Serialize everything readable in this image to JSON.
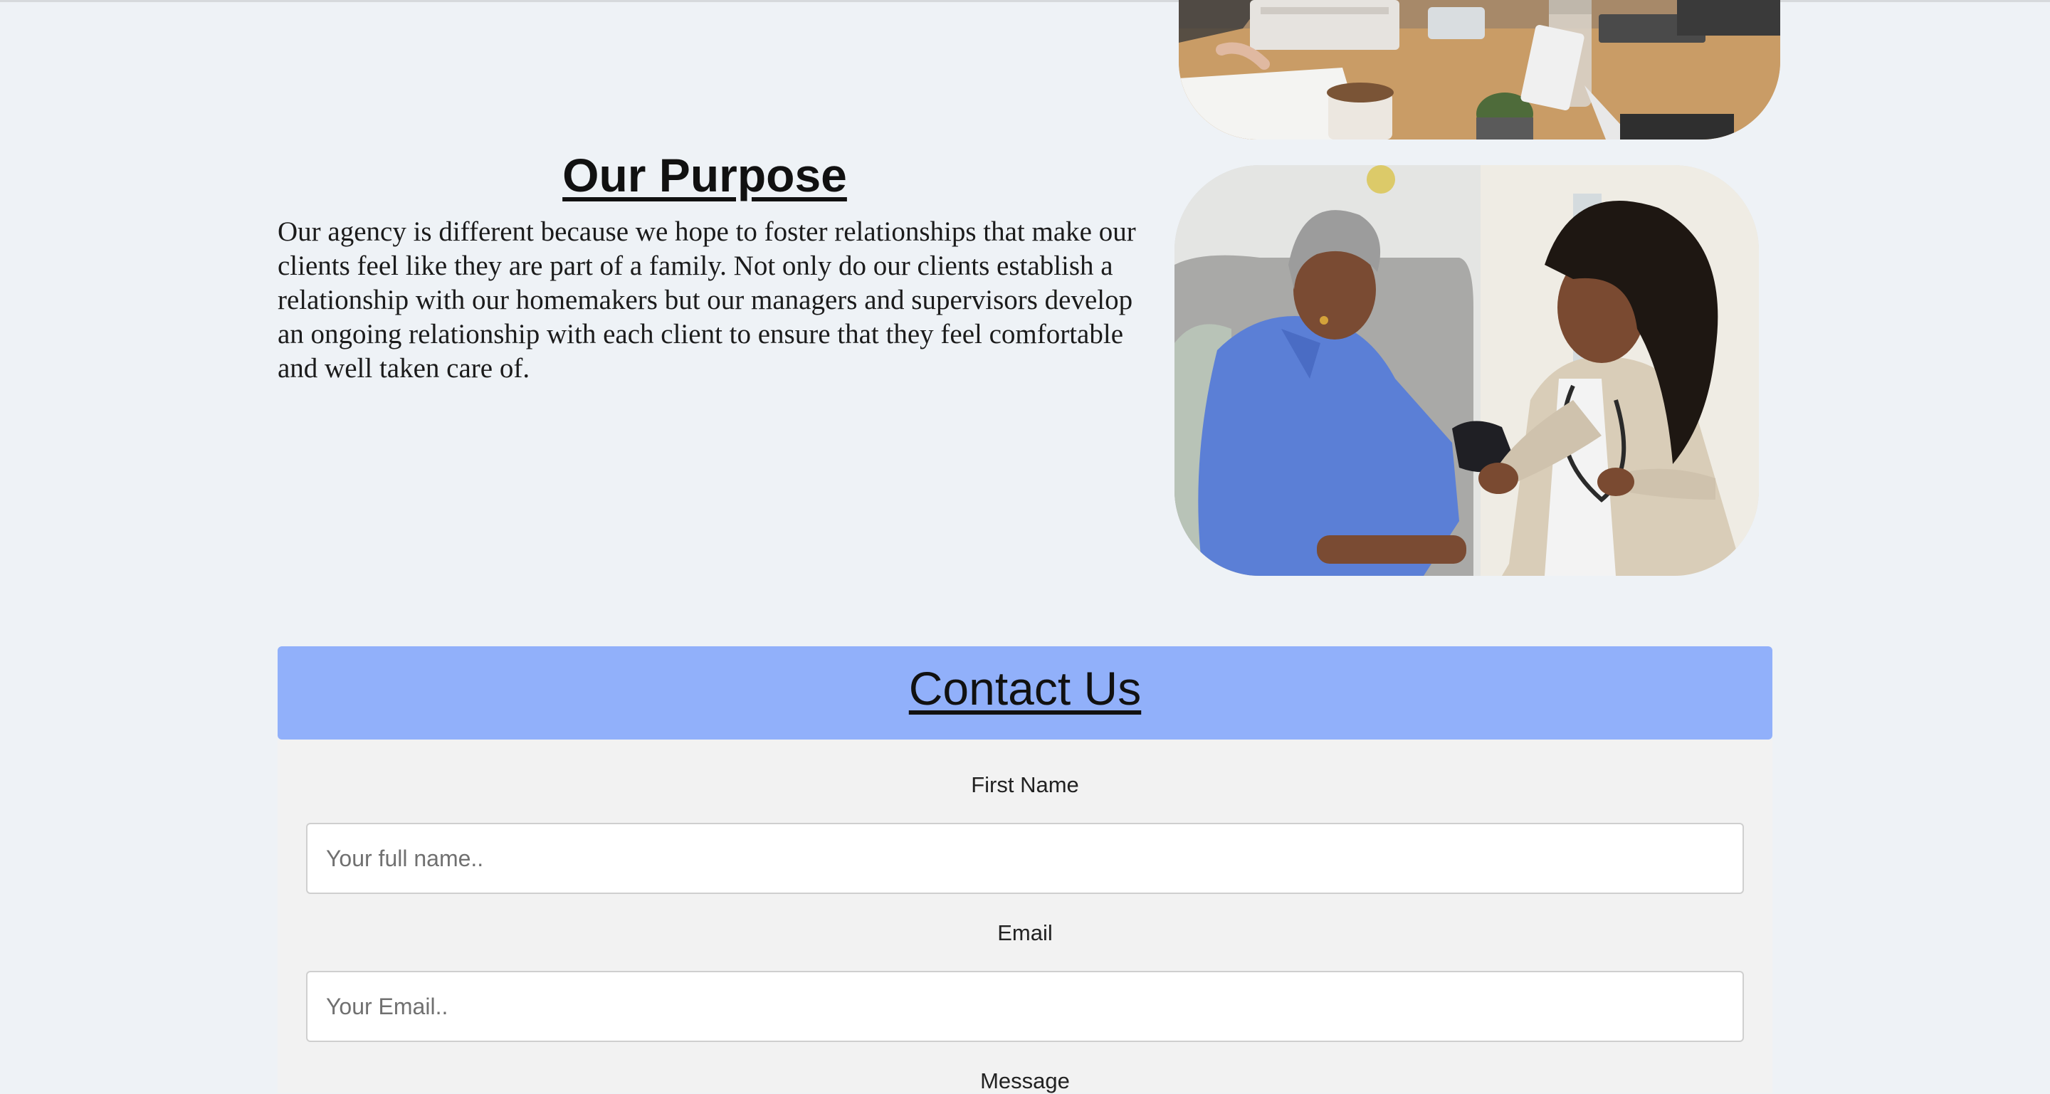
{
  "purpose": {
    "title": "Our Purpose",
    "body": "Our agency is different because we hope to foster relationships that make our clients feel like they are part of a family. Not only do our clients establish a relationship with our homemakers but our managers and supervisors develop an ongoing relationship with each client to ensure that they feel comfortable and well taken care of."
  },
  "contact": {
    "title": "Contact Us",
    "header_color": "#91b0fa",
    "fields": {
      "first_name_label": "First Name",
      "first_name_placeholder": "Your full name..",
      "email_label": "Email",
      "email_placeholder": "Your Email..",
      "message_label": "Message"
    }
  },
  "colors": {
    "page_background": "#eef2f6",
    "form_background": "#f2f2f2"
  }
}
